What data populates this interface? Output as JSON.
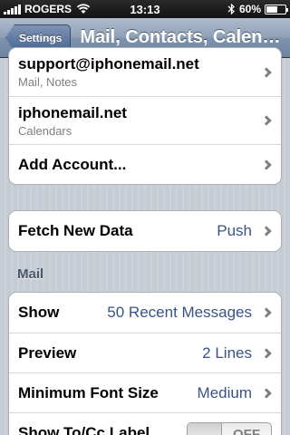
{
  "status": {
    "carrier": "ROGERS",
    "time": "13:13",
    "battery": "60%",
    "battery_level": 0.6,
    "icons": [
      "signal-icon",
      "wifi-icon",
      "bluetooth-icon",
      "battery-icon"
    ]
  },
  "nav": {
    "back_label": "Settings",
    "title": "Mail, Contacts, Calen…"
  },
  "accounts": [
    {
      "name": "support@iphonemail.net",
      "detail": "Mail, Notes"
    },
    {
      "name": "iphonemail.net",
      "detail": "Calendars"
    }
  ],
  "add_account_label": "Add Account...",
  "fetch": {
    "label": "Fetch New Data",
    "value": "Push"
  },
  "mail_section": {
    "header": "Mail",
    "rows": [
      {
        "label": "Show",
        "value": "50 Recent Messages"
      },
      {
        "label": "Preview",
        "value": "2 Lines"
      },
      {
        "label": "Minimum Font Size",
        "value": "Medium"
      }
    ],
    "toggle_row": {
      "label": "Show To/Cc Label",
      "state": "OFF"
    }
  },
  "colors": {
    "accent_value": "#385487",
    "nav_bar": "#6d83a1",
    "background": "#c5ccd4"
  }
}
